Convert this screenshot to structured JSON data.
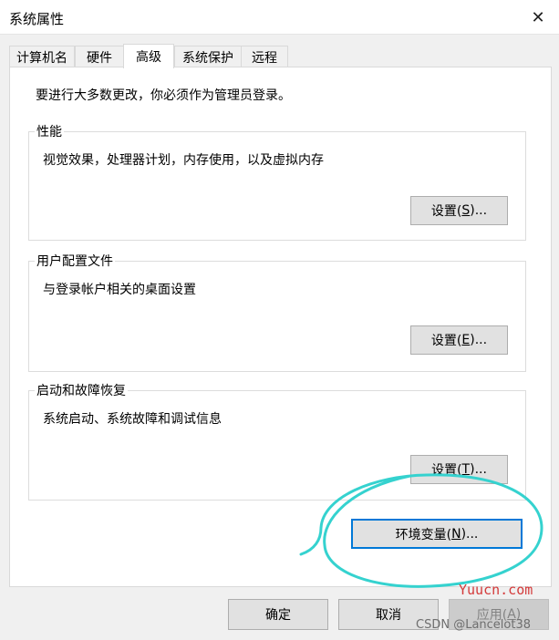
{
  "window": {
    "title": "系统属性",
    "close_label": "✕"
  },
  "tabs": [
    {
      "label": "计算机名",
      "active": false
    },
    {
      "label": "硬件",
      "active": false
    },
    {
      "label": "高级",
      "active": true
    },
    {
      "label": "系统保护",
      "active": false
    },
    {
      "label": "远程",
      "active": false
    }
  ],
  "advanced": {
    "admin_note": "要进行大多数更改，你必须作为管理员登录。",
    "performance": {
      "legend": "性能",
      "description": "视觉效果，处理器计划，内存使用，以及虚拟内存",
      "button": {
        "pre": "设置(",
        "key": "S",
        "post": ")..."
      }
    },
    "user_profiles": {
      "legend": "用户配置文件",
      "description": "与登录帐户相关的桌面设置",
      "button": {
        "pre": "设置(",
        "key": "E",
        "post": ")..."
      }
    },
    "startup_recovery": {
      "legend": "启动和故障恢复",
      "description": "系统启动、系统故障和调试信息",
      "button": {
        "pre": "设置(",
        "key": "T",
        "post": ")..."
      }
    },
    "env_button": {
      "pre": "环境变量(",
      "key": "N",
      "post": ")..."
    }
  },
  "footer": {
    "ok": "确定",
    "cancel": "取消",
    "apply": {
      "pre": "应用(",
      "key": "A",
      "post": ")"
    }
  },
  "watermarks": {
    "site": "Yuucn.com",
    "csdn": "CSDN @Lancelot38"
  },
  "colors": {
    "annotation": "#35d2cf",
    "focus_border": "#0078d7"
  }
}
